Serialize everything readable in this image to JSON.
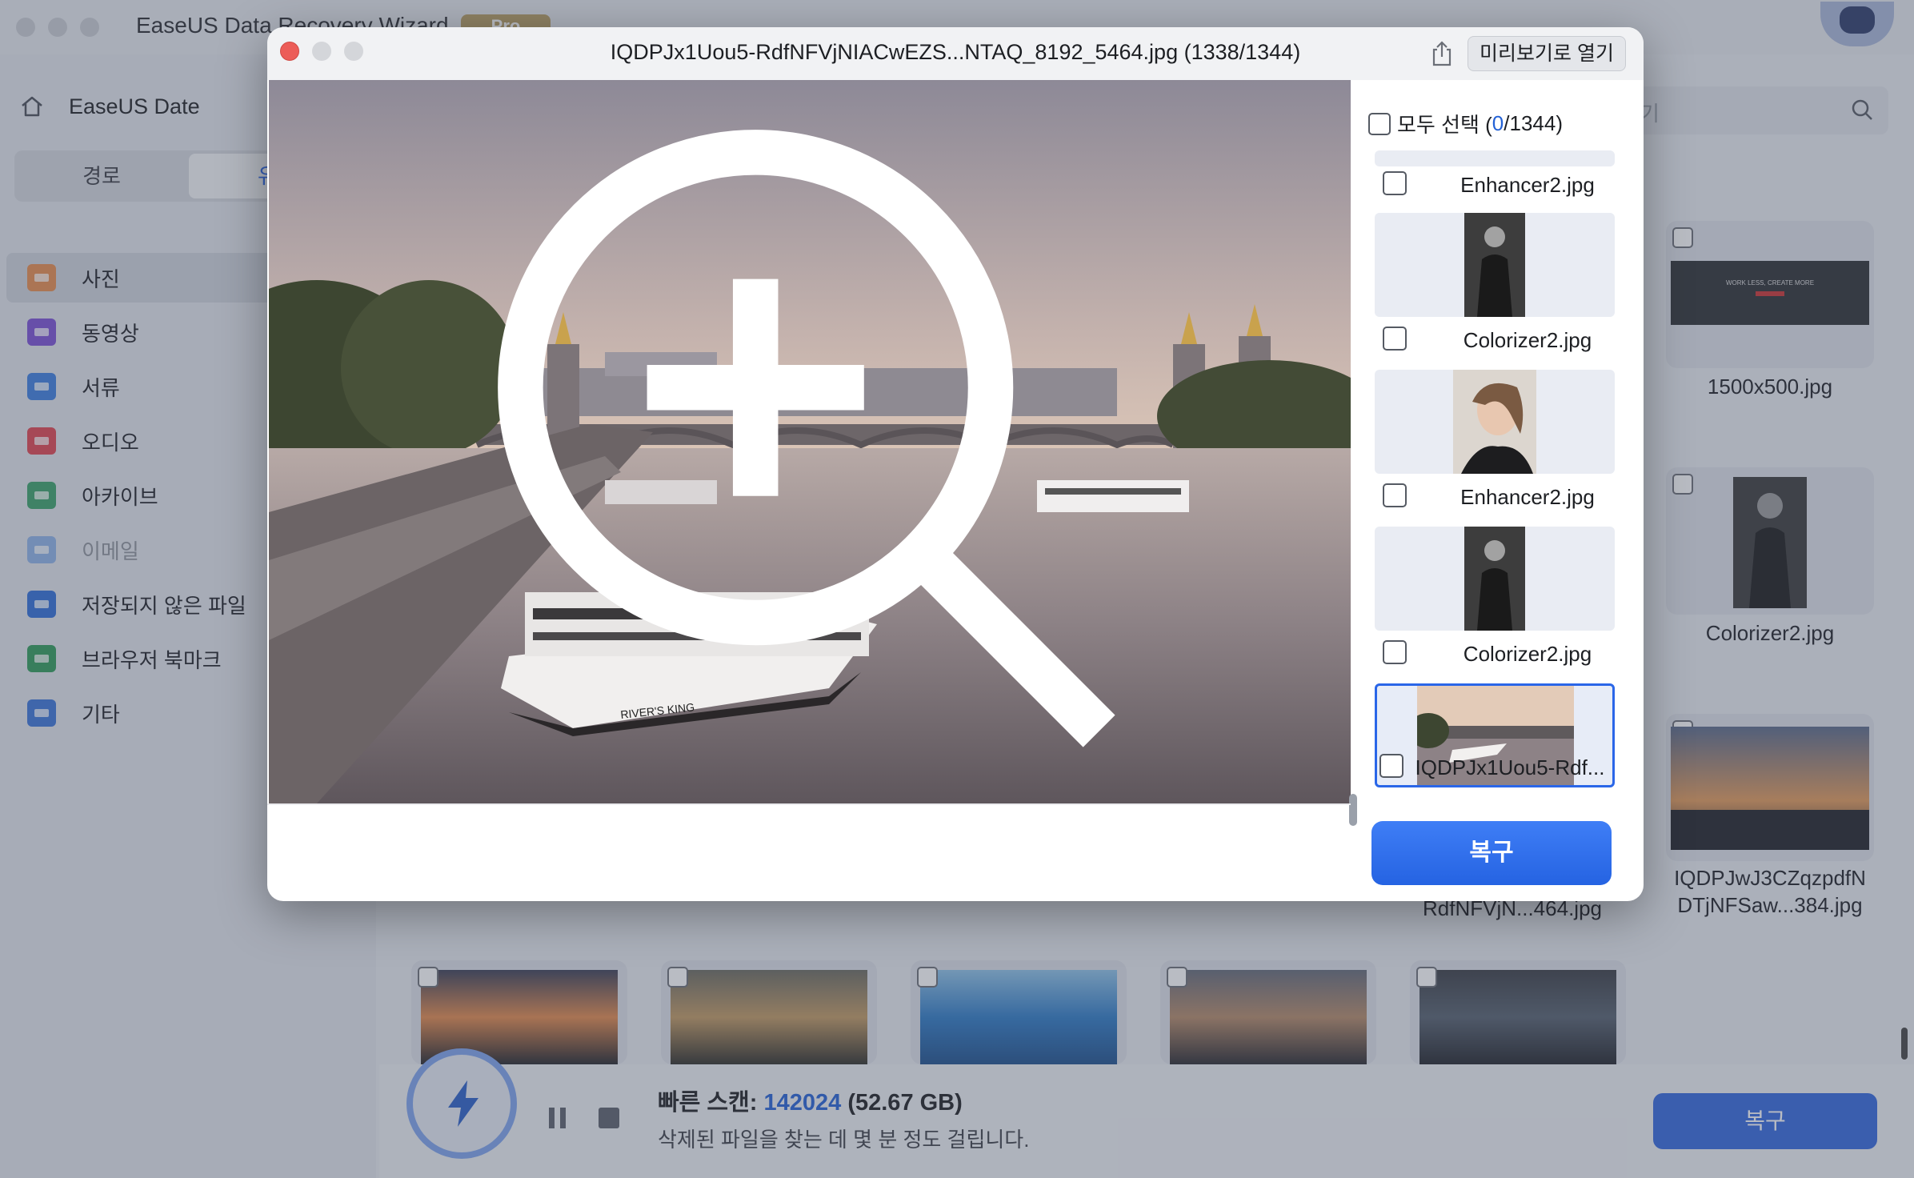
{
  "app": {
    "title": "EaseUS Data Recovery Wizard",
    "pro_badge": "Pro",
    "home_label": "EaseUS Date",
    "segment": {
      "path_label": "경로",
      "type_label": "유"
    },
    "categories": [
      {
        "label": "사진",
        "icon": "photo-folder-icon",
        "color": "#e98d4d",
        "active": true
      },
      {
        "label": "동영상",
        "icon": "video-folder-icon",
        "color": "#7b4fd6"
      },
      {
        "label": "서류",
        "icon": "document-folder-icon",
        "color": "#3d7fe0"
      },
      {
        "label": "오디오",
        "icon": "audio-folder-icon",
        "color": "#e0454f"
      },
      {
        "label": "아카이브",
        "icon": "archive-folder-icon",
        "color": "#3aa26a"
      },
      {
        "label": "이메일",
        "icon": "email-folder-icon",
        "color": "#8fb3e8",
        "disabled": true
      },
      {
        "label": "저장되지 않은 파일",
        "icon": "unsaved-folder-icon",
        "color": "#2f6fd8"
      },
      {
        "label": "브라우저 북마크",
        "icon": "bookmark-folder-icon",
        "color": "#2f9c5a"
      },
      {
        "label": "기타",
        "icon": "other-folder-icon",
        "color": "#3a74d9"
      }
    ],
    "search_placeholder": "기",
    "grid": {
      "labels": [
        "1500x500.jpg",
        "Colorizer2.jpg",
        "IQDPJwJ3CZqzpdfN\nDTjNFSaw...384.jpg",
        "RdfNFVjN...464.jpg"
      ]
    },
    "scan": {
      "prefix": "빠른 스캔: ",
      "count": "142024",
      "size": " (52.67 GB)",
      "message": "삭제된 파일을 찾는 데 몇 분 정도 걸립니다."
    },
    "recover_label": "복구"
  },
  "modal": {
    "title": "IQDPJx1Uou5-RdfNFVjNIACwEZS...NTAQ_8192_5464.jpg (1338/1344)",
    "open_preview_label": "미리보기로 열기",
    "select_all": {
      "label": "모두 선택 (",
      "selected": "0",
      "total": "/1344)"
    },
    "thumbnails": [
      {
        "name": "Enhancer2.jpg",
        "kind": "portrait-face"
      },
      {
        "name": "Colorizer2.jpg",
        "kind": "portrait-bw"
      },
      {
        "name": "Enhancer2.jpg",
        "kind": "portrait-face"
      },
      {
        "name": "Colorizer2.jpg",
        "kind": "portrait-bw"
      },
      {
        "name": "IQDPJx1Uou5-Rdf...",
        "kind": "river-boat",
        "selected": true
      }
    ],
    "recover_label": "복구",
    "boat_name": "RIVER'S KING"
  },
  "colors": {
    "accent": "#2a66e8",
    "recover_button": "#2563e2",
    "close_button": "#ec5d58"
  }
}
